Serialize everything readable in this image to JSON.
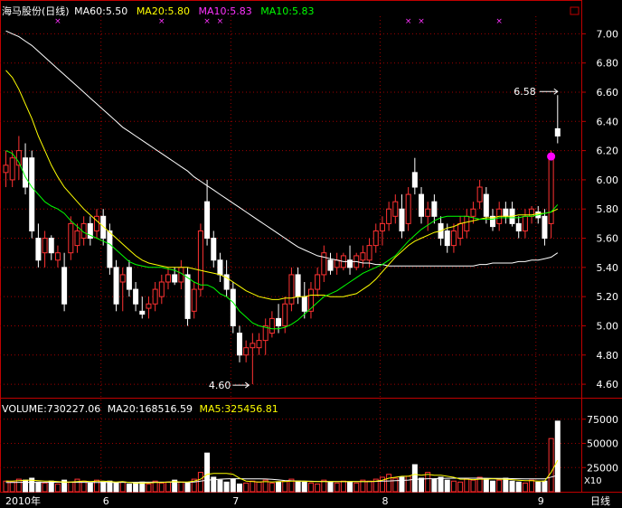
{
  "header": {
    "title": "海马股份(日线)",
    "ma_items": [
      {
        "label": "MA60:5.50",
        "color": "#ffffff"
      },
      {
        "label": "MA20:5.80",
        "color": "#ffff00"
      },
      {
        "label": "MA10:5.83",
        "color": "#ff33ff"
      },
      {
        "label": "MA10:5.83",
        "color": "#00ff00"
      }
    ]
  },
  "vol_header": {
    "items": [
      {
        "label": "VOLUME:730227.06",
        "color": "#ffffff"
      },
      {
        "label": "MA20:168516.59",
        "color": "#ffffff"
      },
      {
        "label": "MA5:325456.81",
        "color": "#ffff00"
      }
    ]
  },
  "axis_bottom": {
    "labels": [
      "2010年",
      "6",
      "7",
      "8",
      "9"
    ],
    "right_label": "日线"
  },
  "volume_unit": "X10",
  "annotations": {
    "high": "6.58",
    "low": "4.60"
  },
  "colors": {
    "up": "#ff3232",
    "down": "#ffffff",
    "grid": "#a00000",
    "axis": "#c00000",
    "ma60": "#ffffff",
    "ma20": "#ffff00",
    "ma10": "#00ff00",
    "marker": "#ff00ff"
  },
  "chart_data": [
    {
      "type": "candlestick",
      "name": "price",
      "yticks": [
        "7.00",
        "6.80",
        "6.60",
        "6.40",
        "6.20",
        "6.00",
        "5.80",
        "5.60",
        "5.40",
        "5.20",
        "5.00",
        "4.80",
        "4.60"
      ],
      "ylim": [
        4.52,
        7.12
      ],
      "ohlc": [
        [
          6.05,
          6.2,
          5.95,
          6.1
        ],
        [
          6.0,
          6.2,
          5.95,
          6.15
        ],
        [
          6.1,
          6.3,
          6.0,
          6.2
        ],
        [
          6.15,
          6.25,
          5.9,
          5.95
        ],
        [
          6.15,
          6.2,
          5.6,
          5.65
        ],
        [
          5.6,
          5.7,
          5.4,
          5.45
        ],
        [
          5.5,
          5.65,
          5.4,
          5.6
        ],
        [
          5.6,
          5.62,
          5.45,
          5.5
        ],
        [
          5.45,
          5.55,
          5.4,
          5.5
        ],
        [
          5.4,
          5.5,
          5.1,
          5.15
        ],
        [
          5.5,
          5.75,
          5.45,
          5.7
        ],
        [
          5.55,
          5.7,
          5.5,
          5.65
        ],
        [
          5.6,
          5.75,
          5.55,
          5.7
        ],
        [
          5.7,
          5.75,
          5.55,
          5.6
        ],
        [
          5.65,
          5.8,
          5.6,
          5.75
        ],
        [
          5.75,
          5.8,
          5.55,
          5.6
        ],
        [
          5.65,
          5.7,
          5.35,
          5.4
        ],
        [
          5.4,
          5.45,
          5.1,
          5.15
        ],
        [
          5.3,
          5.4,
          5.1,
          5.35
        ],
        [
          5.4,
          5.45,
          5.2,
          5.25
        ],
        [
          5.25,
          5.3,
          5.1,
          5.15
        ],
        [
          5.1,
          5.2,
          5.05,
          5.08
        ],
        [
          5.12,
          5.2,
          5.05,
          5.15
        ],
        [
          5.15,
          5.3,
          5.1,
          5.25
        ],
        [
          5.2,
          5.35,
          5.15,
          5.3
        ],
        [
          5.3,
          5.4,
          5.25,
          5.35
        ],
        [
          5.35,
          5.4,
          5.28,
          5.3
        ],
        [
          5.3,
          5.45,
          5.25,
          5.4
        ],
        [
          5.35,
          5.4,
          5.0,
          5.05
        ],
        [
          5.1,
          5.3,
          5.05,
          5.25
        ],
        [
          5.25,
          5.7,
          5.2,
          5.65
        ],
        [
          5.85,
          6.0,
          5.55,
          5.6
        ],
        [
          5.6,
          5.65,
          5.4,
          5.45
        ],
        [
          5.45,
          5.5,
          5.3,
          5.35
        ],
        [
          5.35,
          5.45,
          5.2,
          5.25
        ],
        [
          5.25,
          5.3,
          4.95,
          5.0
        ],
        [
          4.95,
          5.0,
          4.75,
          4.8
        ],
        [
          4.8,
          4.9,
          4.75,
          4.85
        ],
        [
          4.85,
          4.95,
          4.6,
          4.88
        ],
        [
          4.85,
          4.95,
          4.8,
          4.9
        ],
        [
          4.9,
          5.05,
          4.8,
          5.0
        ],
        [
          4.95,
          5.1,
          4.92,
          5.05
        ],
        [
          5.05,
          5.15,
          4.95,
          5.0
        ],
        [
          5.0,
          5.2,
          4.95,
          5.15
        ],
        [
          5.15,
          5.4,
          5.1,
          5.35
        ],
        [
          5.35,
          5.4,
          5.15,
          5.2
        ],
        [
          5.2,
          5.3,
          5.05,
          5.1
        ],
        [
          5.1,
          5.3,
          5.05,
          5.25
        ],
        [
          5.25,
          5.4,
          5.2,
          5.35
        ],
        [
          5.35,
          5.55,
          5.3,
          5.5
        ],
        [
          5.45,
          5.5,
          5.35,
          5.38
        ],
        [
          5.4,
          5.5,
          5.35,
          5.45
        ],
        [
          5.4,
          5.5,
          5.38,
          5.48
        ],
        [
          5.45,
          5.55,
          5.35,
          5.4
        ],
        [
          5.4,
          5.5,
          5.38,
          5.48
        ],
        [
          5.45,
          5.55,
          5.4,
          5.5
        ],
        [
          5.45,
          5.6,
          5.4,
          5.55
        ],
        [
          5.55,
          5.7,
          5.5,
          5.65
        ],
        [
          5.65,
          5.75,
          5.55,
          5.7
        ],
        [
          5.7,
          5.85,
          5.65,
          5.8
        ],
        [
          5.75,
          5.9,
          5.7,
          5.85
        ],
        [
          5.8,
          5.9,
          5.6,
          5.65
        ],
        [
          5.7,
          5.95,
          5.65,
          5.9
        ],
        [
          6.05,
          6.15,
          5.9,
          5.95
        ],
        [
          5.9,
          5.95,
          5.7,
          5.75
        ],
        [
          5.75,
          5.85,
          5.65,
          5.8
        ],
        [
          5.85,
          5.9,
          5.7,
          5.75
        ],
        [
          5.7,
          5.75,
          5.55,
          5.6
        ],
        [
          5.65,
          5.7,
          5.5,
          5.55
        ],
        [
          5.55,
          5.7,
          5.5,
          5.65
        ],
        [
          5.6,
          5.75,
          5.55,
          5.7
        ],
        [
          5.65,
          5.8,
          5.6,
          5.75
        ],
        [
          5.75,
          5.85,
          5.7,
          5.8
        ],
        [
          5.85,
          6.0,
          5.8,
          5.95
        ],
        [
          5.9,
          5.95,
          5.7,
          5.75
        ],
        [
          5.75,
          5.8,
          5.65,
          5.68
        ],
        [
          5.7,
          5.85,
          5.65,
          5.8
        ],
        [
          5.8,
          5.85,
          5.7,
          5.75
        ],
        [
          5.8,
          5.85,
          5.68,
          5.7
        ],
        [
          5.7,
          5.75,
          5.6,
          5.65
        ],
        [
          5.65,
          5.8,
          5.6,
          5.75
        ],
        [
          5.75,
          5.82,
          5.7,
          5.8
        ],
        [
          5.78,
          5.82,
          5.7,
          5.74
        ],
        [
          5.75,
          5.8,
          5.55,
          5.6
        ],
        [
          5.7,
          6.2,
          5.6,
          6.18
        ],
        [
          6.35,
          6.58,
          6.25,
          6.3
        ]
      ],
      "series": [
        {
          "name": "MA60",
          "color": "#ffffff",
          "values": [
            7.02,
            7.0,
            6.98,
            6.95,
            6.92,
            6.88,
            6.84,
            6.8,
            6.76,
            6.72,
            6.68,
            6.64,
            6.6,
            6.56,
            6.52,
            6.48,
            6.44,
            6.4,
            6.36,
            6.33,
            6.3,
            6.27,
            6.24,
            6.21,
            6.18,
            6.15,
            6.12,
            6.09,
            6.06,
            6.02,
            5.99,
            5.96,
            5.93,
            5.9,
            5.87,
            5.84,
            5.81,
            5.78,
            5.75,
            5.72,
            5.69,
            5.66,
            5.63,
            5.6,
            5.57,
            5.54,
            5.52,
            5.5,
            5.48,
            5.47,
            5.46,
            5.45,
            5.44,
            5.44,
            5.44,
            5.43,
            5.43,
            5.42,
            5.42,
            5.41,
            5.41,
            5.41,
            5.41,
            5.41,
            5.41,
            5.41,
            5.41,
            5.41,
            5.41,
            5.41,
            5.41,
            5.41,
            5.41,
            5.42,
            5.42,
            5.43,
            5.43,
            5.43,
            5.43,
            5.44,
            5.44,
            5.45,
            5.45,
            5.46,
            5.47,
            5.5
          ]
        },
        {
          "name": "MA20",
          "color": "#ffff00",
          "values": [
            6.75,
            6.7,
            6.62,
            6.52,
            6.42,
            6.3,
            6.2,
            6.1,
            6.02,
            5.95,
            5.9,
            5.85,
            5.8,
            5.76,
            5.72,
            5.68,
            5.64,
            5.6,
            5.56,
            5.52,
            5.48,
            5.45,
            5.43,
            5.42,
            5.41,
            5.4,
            5.4,
            5.4,
            5.4,
            5.39,
            5.38,
            5.37,
            5.36,
            5.35,
            5.33,
            5.3,
            5.27,
            5.24,
            5.22,
            5.2,
            5.19,
            5.18,
            5.18,
            5.19,
            5.19,
            5.2,
            5.2,
            5.21,
            5.21,
            5.21,
            5.2,
            5.2,
            5.2,
            5.21,
            5.22,
            5.25,
            5.28,
            5.32,
            5.37,
            5.42,
            5.47,
            5.51,
            5.55,
            5.58,
            5.6,
            5.62,
            5.64,
            5.65,
            5.67,
            5.68,
            5.7,
            5.71,
            5.72,
            5.73,
            5.74,
            5.74,
            5.75,
            5.75,
            5.75,
            5.76,
            5.76,
            5.76,
            5.77,
            5.77,
            5.78,
            5.8
          ]
        },
        {
          "name": "MA10",
          "color": "#00ff00",
          "values": [
            6.2,
            6.18,
            6.12,
            6.02,
            5.95,
            5.9,
            5.85,
            5.82,
            5.8,
            5.77,
            5.72,
            5.68,
            5.64,
            5.62,
            5.6,
            5.58,
            5.56,
            5.52,
            5.48,
            5.44,
            5.42,
            5.41,
            5.4,
            5.4,
            5.4,
            5.39,
            5.38,
            5.36,
            5.33,
            5.3,
            5.28,
            5.28,
            5.26,
            5.22,
            5.2,
            5.16,
            5.1,
            5.06,
            5.02,
            5.0,
            4.99,
            4.98,
            4.98,
            4.99,
            5.01,
            5.04,
            5.08,
            5.12,
            5.16,
            5.2,
            5.22,
            5.24,
            5.27,
            5.3,
            5.33,
            5.36,
            5.38,
            5.4,
            5.42,
            5.45,
            5.48,
            5.53,
            5.58,
            5.62,
            5.66,
            5.69,
            5.72,
            5.74,
            5.75,
            5.75,
            5.75,
            5.75,
            5.74,
            5.73,
            5.73,
            5.73,
            5.74,
            5.74,
            5.74,
            5.74,
            5.75,
            5.75,
            5.76,
            5.77,
            5.78,
            5.83
          ]
        }
      ],
      "highlight": {
        "index": 84,
        "value": 6.16
      }
    },
    {
      "type": "bar",
      "name": "volume",
      "yticks": [
        "75000",
        "50000",
        "25000"
      ],
      "ylim": [
        0,
        86000
      ],
      "values": [
        11000,
        10000,
        13000,
        12000,
        14000,
        10000,
        9000,
        11000,
        8000,
        12000,
        10000,
        13000,
        11000,
        9000,
        12000,
        10000,
        11000,
        9000,
        10000,
        8000,
        9000,
        10000,
        8000,
        11000,
        9000,
        10000,
        12000,
        10000,
        9000,
        13000,
        20000,
        40000,
        15000,
        12000,
        10000,
        13000,
        8000,
        9000,
        11000,
        10000,
        12000,
        9000,
        10000,
        11000,
        13000,
        11000,
        10000,
        9000,
        8000,
        12000,
        10000,
        9000,
        11000,
        10000,
        9000,
        12000,
        11000,
        13000,
        15000,
        18000,
        14000,
        15000,
        16000,
        28000,
        14000,
        20000,
        13000,
        15000,
        12000,
        11000,
        10000,
        13000,
        12000,
        15000,
        13000,
        11000,
        12000,
        14000,
        11000,
        10000,
        9000,
        12000,
        10000,
        11000,
        55000,
        73000
      ],
      "ma20": [
        9600,
        9600,
        9700,
        9700,
        9700,
        9700,
        9700,
        9800,
        9800,
        9800,
        9800,
        9700,
        9700,
        9600,
        9600,
        9600,
        9600,
        9600,
        9700,
        9700,
        9800,
        9900,
        9900,
        9900,
        9900,
        9900,
        9800,
        9800,
        9800,
        10000,
        11000,
        12000,
        12500,
        13000,
        13300,
        13500,
        13500,
        13400,
        13300,
        13300,
        13200,
        12800,
        12200,
        11600,
        11300,
        11000,
        10900,
        10800,
        10700,
        10700,
        10600,
        10600,
        10600,
        10500,
        10500,
        10500,
        10600,
        10700,
        10900,
        11100,
        11400,
        11700,
        12100,
        12800,
        13100,
        13500,
        13600,
        13800,
        13900,
        14000,
        14000,
        14000,
        14000,
        14000,
        13900,
        13800,
        13800,
        13700,
        13600,
        13500,
        13400,
        13300,
        13300,
        13300,
        15100,
        16900
      ],
      "ma5": [
        11000,
        11000,
        11500,
        12000,
        12000,
        11500,
        11000,
        11000,
        10500,
        10000,
        10000,
        10500,
        11000,
        10500,
        11000,
        11000,
        10500,
        10000,
        10500,
        9500,
        9000,
        9000,
        9000,
        9500,
        9500,
        10000,
        10500,
        10000,
        10000,
        11000,
        13000,
        18000,
        19000,
        19000,
        19000,
        18000,
        14000,
        11000,
        10500,
        10000,
        10500,
        10000,
        10500,
        10500,
        11000,
        11000,
        11000,
        10500,
        10500,
        10500,
        10500,
        10500,
        10500,
        10500,
        10500,
        10500,
        10500,
        11000,
        12000,
        14000,
        15000,
        16000,
        16000,
        18000,
        17000,
        18000,
        17000,
        17000,
        16000,
        15000,
        13000,
        13000,
        12500,
        13000,
        13000,
        13500,
        13000,
        13000,
        12500,
        12000,
        11500,
        11500,
        11000,
        11000,
        20000,
        32500
      ]
    }
  ]
}
